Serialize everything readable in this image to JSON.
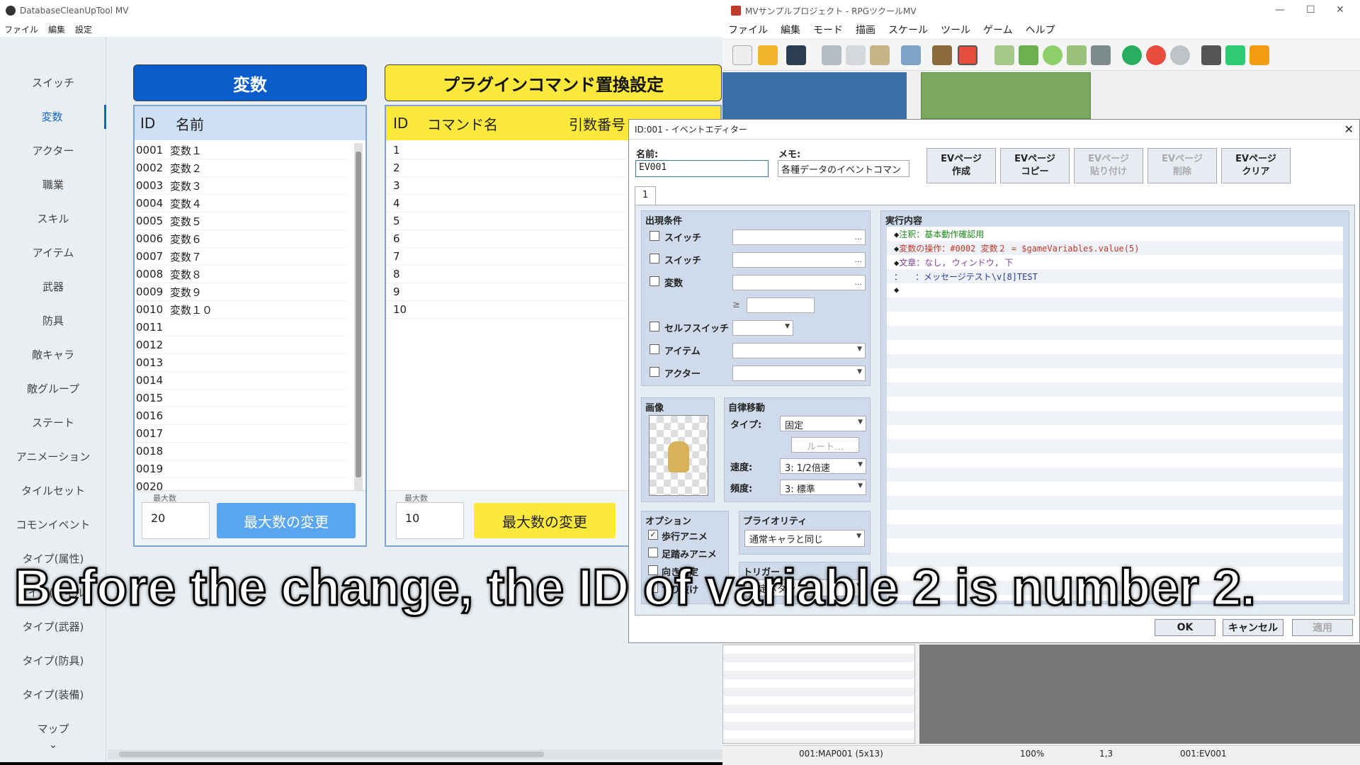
{
  "left_app": {
    "title": "DatabaseCleanUpTool MV",
    "menu": [
      "ファイル",
      "編集",
      "設定"
    ],
    "sidebar": [
      "スイッチ",
      "変数",
      "アクター",
      "職業",
      "スキル",
      "アイテム",
      "武器",
      "防具",
      "敵キャラ",
      "敵グループ",
      "ステート",
      "アニメーション",
      "タイルセット",
      "コモンイベント",
      "タイプ(属性)",
      "タイプ(スキル)",
      "タイプ(武器)",
      "タイプ(防具)",
      "タイプ(装備)",
      "マップ"
    ],
    "sidebar_active": "変数",
    "variables": {
      "header": "変数",
      "col_id": "ID",
      "col_name": "名前",
      "rows": [
        {
          "id": "0001",
          "name": "変数１"
        },
        {
          "id": "0002",
          "name": "変数２"
        },
        {
          "id": "0003",
          "name": "変数３"
        },
        {
          "id": "0004",
          "name": "変数４"
        },
        {
          "id": "0005",
          "name": "変数５"
        },
        {
          "id": "0006",
          "name": "変数６"
        },
        {
          "id": "0007",
          "name": "変数７"
        },
        {
          "id": "0008",
          "name": "変数８"
        },
        {
          "id": "0009",
          "name": "変数９"
        },
        {
          "id": "0010",
          "name": "変数１０"
        },
        {
          "id": "0011",
          "name": ""
        },
        {
          "id": "0012",
          "name": ""
        },
        {
          "id": "0013",
          "name": ""
        },
        {
          "id": "0014",
          "name": ""
        },
        {
          "id": "0015",
          "name": ""
        },
        {
          "id": "0016",
          "name": ""
        },
        {
          "id": "0017",
          "name": ""
        },
        {
          "id": "0018",
          "name": ""
        },
        {
          "id": "0019",
          "name": ""
        },
        {
          "id": "0020",
          "name": ""
        }
      ],
      "max_label": "最大数",
      "max_value": "20",
      "change_button": "最大数の変更"
    },
    "plugin": {
      "header": "プラグインコマンド置換設定",
      "col_id": "ID",
      "col_command": "コマンド名",
      "col_arg": "引数番号",
      "rows": [
        "1",
        "2",
        "3",
        "4",
        "5",
        "6",
        "7",
        "8",
        "9",
        "10"
      ],
      "max_label": "最大数",
      "max_value": "10",
      "change_button": "最大数の変更"
    }
  },
  "right_app": {
    "title": "MVサンプルプロジェクト - RPGツクールMV",
    "window_controls": [
      "—",
      "☐",
      "✕"
    ],
    "menu": [
      "ファイル",
      "編集",
      "モード",
      "描画",
      "スケール",
      "ツール",
      "ゲーム",
      "ヘルプ"
    ],
    "status": [
      "001:MAP001 (5x13)",
      "100%",
      "1,3",
      "001:EV001"
    ]
  },
  "dialog": {
    "title": "ID:001 - イベントエディター",
    "name_label": "名前:",
    "name_value": "EV001",
    "memo_label": "メモ:",
    "memo_value": "各種データのイベントコマン",
    "ev_buttons": [
      {
        "l1": "EVページ",
        "l2": "作成"
      },
      {
        "l1": "EVページ",
        "l2": "コピー"
      },
      {
        "l1": "EVページ",
        "l2": "貼り付け"
      },
      {
        "l1": "EVページ",
        "l2": "削除"
      },
      {
        "l1": "EVページ",
        "l2": "クリア"
      }
    ],
    "page_tab": "1",
    "conditions_label": "出現条件",
    "conditions": [
      "スイッチ",
      "スイッチ",
      "変数",
      "セルフスイッチ",
      "アイテム",
      "アクター"
    ],
    "ge": "≥",
    "ellipsis": "...",
    "image_label": "画像",
    "auto_label": "自律移動",
    "type_label": "タイプ:",
    "type_value": "固定",
    "route_button": "ルート...",
    "speed_label": "速度:",
    "speed_value": "3: 1/2倍速",
    "freq_label": "頻度:",
    "freq_value": "3: 標準",
    "options_label": "オプション",
    "options": [
      "歩行アニメ",
      "足踏みアニメ",
      "向き固定",
      "すり抜け"
    ],
    "priority_label": "プライオリティ",
    "priority_value": "通常キャラと同じ",
    "trigger_label": "トリガー",
    "trigger_value": "決定ボタン",
    "exec_label": "実行内容",
    "commands": [
      {
        "mark": "◆",
        "head": "注釈：",
        "text": "基本動作確認用",
        "color": "#1a8a1a"
      },
      {
        "mark": "◆",
        "head": "変数の操作：",
        "text": "#0002 変数２ = $gameVariables.value(5)",
        "color": "#c0392b"
      },
      {
        "mark": "◆",
        "head": "文章：",
        "text": "なし, ウィンドウ, 下",
        "color": "#7d3c98"
      },
      {
        "mark": "：",
        "head": "　　：",
        "text": "メッセージテスト\\v[8]TEST",
        "color": "#2c3e9a"
      },
      {
        "mark": "◆",
        "head": "",
        "text": "",
        "color": "#000"
      }
    ],
    "ok": "OK",
    "cancel": "キャンセル",
    "apply": "適用"
  },
  "subtitle": "Before the change, the ID of variable 2 is number 2."
}
